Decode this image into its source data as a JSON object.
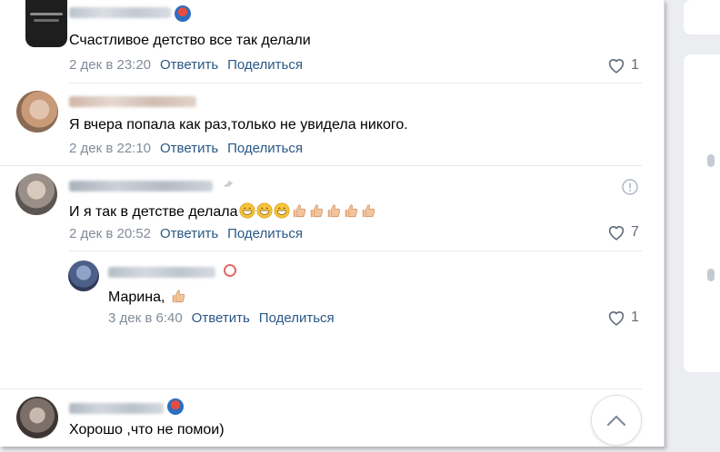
{
  "comments": [
    {
      "text": "Счастливое детство все так делали",
      "date": "2 дек в 23:20",
      "reply": "Ответить",
      "share": "Поделиться",
      "likes": "1"
    },
    {
      "text": "Я вчера попала как раз,только не увидела никого.",
      "date": "2 дек в 22:10",
      "reply": "Ответить",
      "share": "Поделиться"
    },
    {
      "text": "И я так в детстве делала",
      "date": "2 дек в 20:52",
      "reply": "Ответить",
      "share": "Поделиться",
      "likes": "7"
    },
    {
      "text": "Марина,",
      "date": "3 дек в 6:40",
      "reply": "Ответить",
      "share": "Поделиться",
      "likes": "1"
    },
    {
      "text": "Хорошо ,что не помои)"
    }
  ],
  "icons": {
    "like": "heart-outline-icon",
    "report": "exclamation-circle-icon",
    "scroll_up": "chevron-up-icon",
    "emoji_grin": "grinning-face-emoji",
    "emoji_thumb": "thumbs-up-emoji"
  },
  "colors": {
    "link": "#2a5885",
    "meta": "#818c99",
    "divider": "#e7e8ec"
  }
}
